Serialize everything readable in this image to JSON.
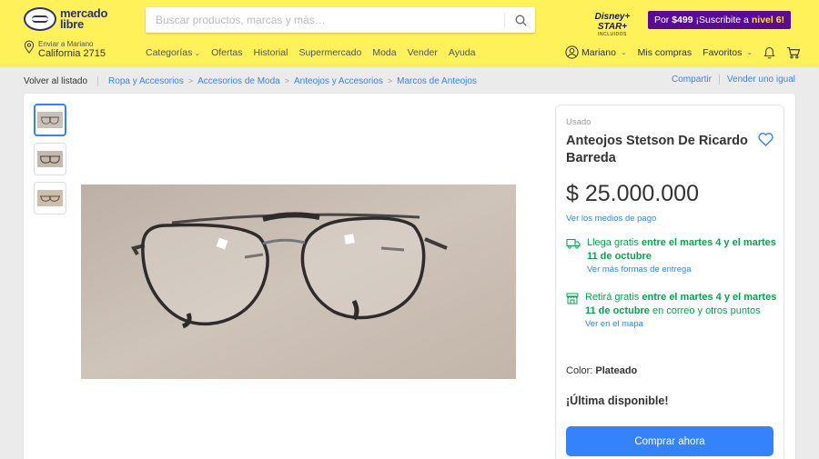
{
  "brand": {
    "line1": "mercado",
    "line2": "libre"
  },
  "search": {
    "placeholder": "Buscar productos, marcas y más…"
  },
  "disney": {
    "line1": "Disney+ STAR+",
    "line2": "INCLUIDOS"
  },
  "promo": {
    "prefix": "Por",
    "price": "$499",
    "text": "¡Suscribite a",
    "level": "nivel 6!"
  },
  "address": {
    "line1": "Enviar a Mariano",
    "line2": "California 2715"
  },
  "nav": [
    "Categorías",
    "Ofertas",
    "Historial",
    "Supermercado",
    "Moda",
    "Vender",
    "Ayuda"
  ],
  "user": {
    "name": "Mariano",
    "purchases": "Mis compras",
    "favorites": "Favoritos"
  },
  "breadcrumb": {
    "back": "Volver al listado",
    "items": [
      "Ropa y Accesorios",
      "Accesorios de Moda",
      "Anteojos y Accesorios",
      "Marcos de Anteojos"
    ],
    "share": "Compartir",
    "sell_same": "Vender uno igual"
  },
  "product": {
    "condition": "Usado",
    "title": "Anteojos Stetson De Ricardo Barreda",
    "price": "$ 25.000.000",
    "payment_link": "Ver los medios de pago",
    "shipping": {
      "prefix": "Llega gratis",
      "date": "entre el martes 4 y el martes 11 de octubre",
      "link": "Ver más formas de entrega"
    },
    "pickup": {
      "prefix": "Retirá gratis",
      "date": "entre el martes 4 y el martes 11 de octubre",
      "suffix": "en correo y otros puntos",
      "link": "Ver en el mapa"
    },
    "color_label": "Color:",
    "color_value": "Plateado",
    "stock": "¡Última disponible!",
    "buy_button": "Comprar ahora"
  },
  "colors": {
    "header": "#fff159",
    "accent": "#3483fa",
    "green": "#00a650",
    "promo": "#5a0a9b"
  }
}
